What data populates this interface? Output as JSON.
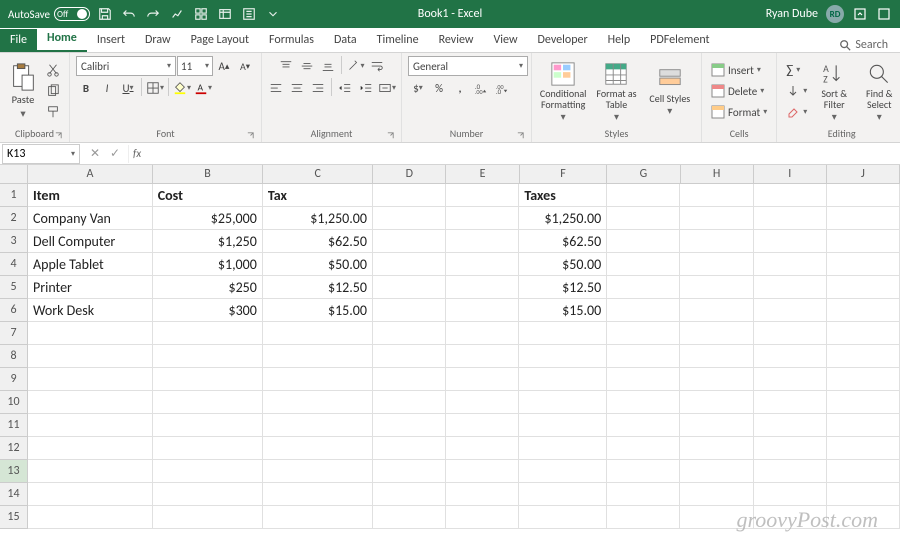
{
  "titlebar": {
    "autosave_label": "AutoSave",
    "autosave_state": "Off",
    "title": "Book1 - Excel",
    "username": "Ryan Dube",
    "initials": "RD"
  },
  "tabs": {
    "file": "File",
    "home": "Home",
    "insert": "Insert",
    "draw": "Draw",
    "pagelayout": "Page Layout",
    "formulas": "Formulas",
    "data": "Data",
    "timeline": "Timeline",
    "review": "Review",
    "view": "View",
    "developer": "Developer",
    "help": "Help",
    "pdf": "PDFelement",
    "search": "Search"
  },
  "ribbon": {
    "clipboard": {
      "label": "Clipboard",
      "paste": "Paste"
    },
    "font": {
      "label": "Font",
      "name": "Calibri",
      "size": "11"
    },
    "alignment": {
      "label": "Alignment"
    },
    "number": {
      "label": "Number",
      "format": "General"
    },
    "styles": {
      "label": "Styles",
      "cond": "Conditional\nFormatting",
      "fat": "Format as\nTable",
      "cell": "Cell\nStyles"
    },
    "cells": {
      "label": "Cells",
      "insert": "Insert",
      "delete": "Delete",
      "format": "Format"
    },
    "editing": {
      "label": "Editing",
      "sort": "Sort &\nFilter",
      "find": "Find &\nSelect"
    }
  },
  "namebox": "K13",
  "columns": [
    "A",
    "B",
    "C",
    "D",
    "E",
    "F",
    "G",
    "H",
    "I",
    "J"
  ],
  "rows": [
    "1",
    "2",
    "3",
    "4",
    "5",
    "6",
    "7",
    "8",
    "9",
    "10",
    "11",
    "12",
    "13",
    "14",
    "15"
  ],
  "headers": {
    "A": "Item",
    "B": "Cost",
    "C": "Tax",
    "F": "Taxes"
  },
  "data": [
    {
      "A": "Company Van",
      "B": "$25,000",
      "C": "$1,250.00",
      "F": "$1,250.00"
    },
    {
      "A": "Dell Computer",
      "B": "$1,250",
      "C": "$62.50",
      "F": "$62.50"
    },
    {
      "A": "Apple Tablet",
      "B": "$1,000",
      "C": "$50.00",
      "F": "$50.00"
    },
    {
      "A": "Printer",
      "B": "$250",
      "C": "$12.50",
      "F": "$12.50"
    },
    {
      "A": "Work Desk",
      "B": "$300",
      "C": "$15.00",
      "F": "$15.00"
    }
  ],
  "selected_cell": {
    "row": 13,
    "col": "K"
  },
  "watermark": "groovyPost.com"
}
